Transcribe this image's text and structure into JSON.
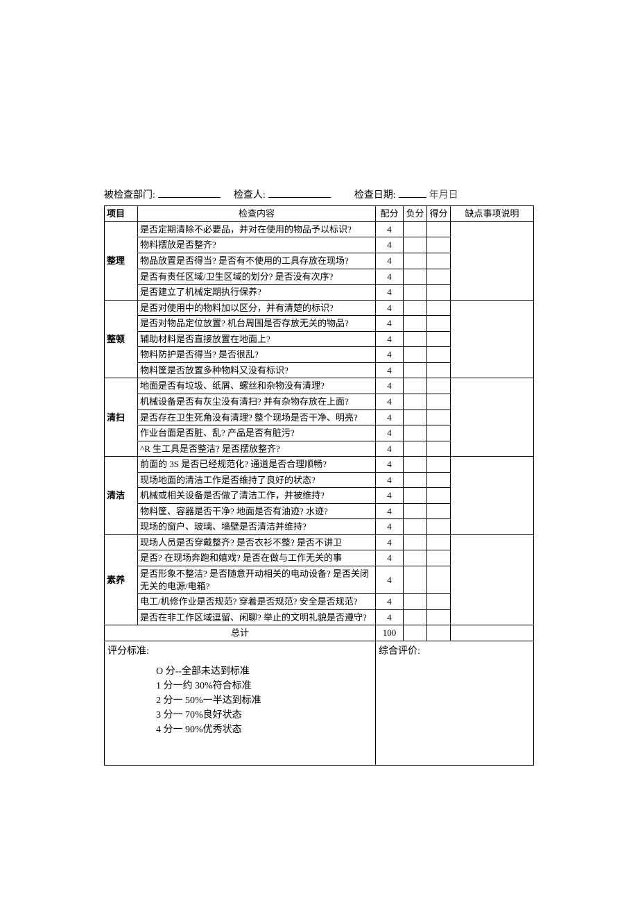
{
  "header": {
    "dept_label": "被检查部门:",
    "inspector_label": "检查人:",
    "date_label": "检查日期:",
    "date_placeholder": "年月日"
  },
  "columns": {
    "c0": "项目",
    "c1": "检查内容",
    "c2": "配分",
    "c3": "负分",
    "c4": "得分",
    "c5": "缺点事项说明"
  },
  "sections": [
    {
      "name": "整理",
      "rows": [
        {
          "text": "是否定期清除不必要品，并对在使用的物品予以标识?",
          "score": "4"
        },
        {
          "text": "物料摆放是否整齐?",
          "score": "4"
        },
        {
          "text": "物品放置是否得当? 是否有不使用的工具存放在现场?",
          "score": "4"
        },
        {
          "text": "是否有责任区域/卫生区域的划分? 是否没有次序?",
          "score": "4"
        },
        {
          "text": "是否建立了机械定期执行保养?",
          "score": "4"
        }
      ]
    },
    {
      "name": "整顿",
      "rows": [
        {
          "text": "是否对使用中的物料加以区分，并有清楚的标识?",
          "score": "4"
        },
        {
          "text": "是否对物品定位放置? 机台周围是否存放无关的物品?",
          "score": "4"
        },
        {
          "text": "辅助材料是否直接放置在地面上?",
          "score": "4"
        },
        {
          "text": "物料防护是否得当? 是否很乱?",
          "score": "4"
        },
        {
          "text": "物料筐是否放置多种物料又没有标识?",
          "score": "4"
        }
      ]
    },
    {
      "name": "清扫",
      "rows": [
        {
          "text": "地面是否有垃圾、纸屑、螺丝和杂物没有清理?",
          "score": "4"
        },
        {
          "text": "机械设备是否有灰尘没有清扫? 并有杂物存放在上面?",
          "score": "4"
        },
        {
          "text": "是否存在卫生死角没有清理? 整个现场是否干净、明亮?",
          "score": "4"
        },
        {
          "text": "作业台面是否脏、乱? 产品是否有脏污?",
          "score": "4"
        },
        {
          "text": "^R 生工具是否整洁? 是否摆放整齐?",
          "score": "4"
        }
      ]
    },
    {
      "name": "清洁",
      "rows": [
        {
          "text": "前面的 3S 是否已经规范化? 通道是否合理顺畅?",
          "score": "4"
        },
        {
          "text": "现场地面的清洁工作是否维持了良好的状态?",
          "score": "4"
        },
        {
          "text": "机械或相关设备是否做了清洁工作，并被维持?",
          "score": "4"
        },
        {
          "text": "物料筐、容器是否干净? 地面是否有油迹? 水迹?",
          "score": "4"
        },
        {
          "text": "现场的窗户、玻璃、墙壁是否清洁并维持?",
          "score": "4"
        }
      ]
    },
    {
      "name": "素养",
      "rows": [
        {
          "text": "现场人员是否穿戴整齐? 是否衣衫不整? 是否不讲卫",
          "score": "4"
        },
        {
          "text": "是否? 在现场奔跑和嬉戏? 是否在做与工作无关的事",
          "score": "4"
        },
        {
          "text": "是否形象不整洁? 是否随意开动相关的电动设备? 是否关闭无关的电源/电箱?",
          "score": "4"
        },
        {
          "text": "电工/机修作业是否规范? 穿着是否规范? 安全是否规范?",
          "score": "4"
        },
        {
          "text": "是否在非工作区域逗留、闲聊? 举止的文明礼貌是否遵守?",
          "score": "4"
        }
      ]
    }
  ],
  "total": {
    "label": "总计",
    "value": "100"
  },
  "standards": {
    "title": "评分标准:",
    "lines": [
      "O 分--全部未达到标准",
      "1 分一约 30%符合标准",
      "2 分一 50%一半达到标准",
      "3 分一 70%良好状态",
      "4 分一 90%优秀状态"
    ]
  },
  "evaluation": {
    "title": "综合评价:"
  }
}
